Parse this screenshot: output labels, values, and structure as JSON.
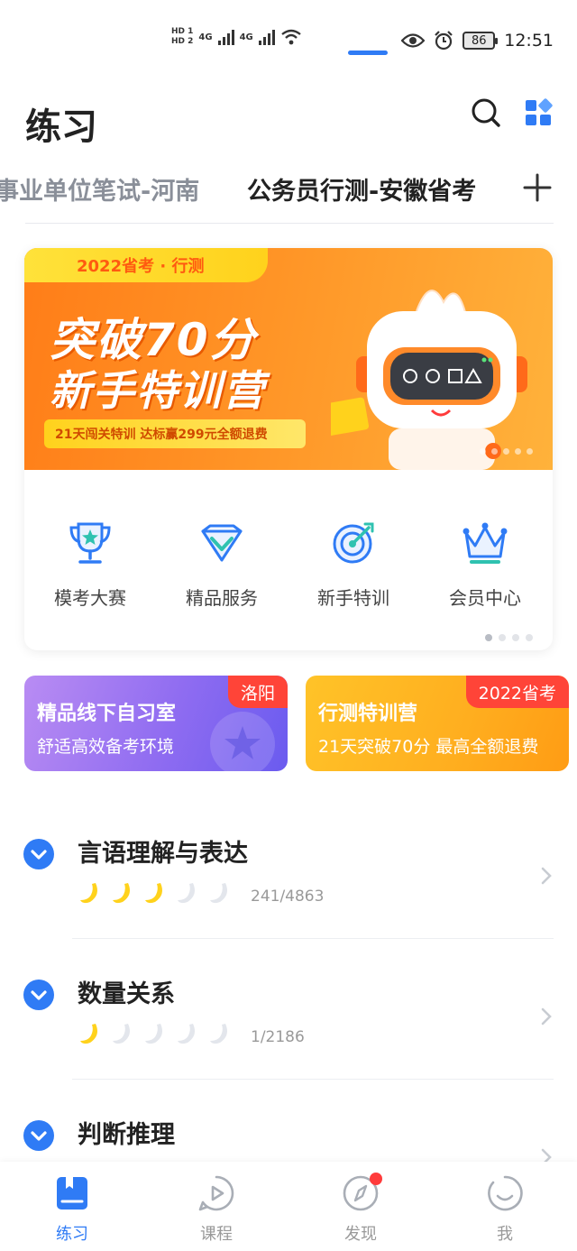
{
  "status_bar": {
    "sim1": "HD 1",
    "sim2": "HD 2",
    "net1": "4G",
    "net2": "4G",
    "battery": "86",
    "time": "12:51"
  },
  "header": {
    "title": "练习",
    "icons": [
      "search-icon",
      "grid-icon"
    ]
  },
  "tabs": {
    "items": [
      "事业单位笔试-河南",
      "公务员行测-安徽省考"
    ],
    "active_index": 1,
    "add_icon": "plus-icon"
  },
  "banner": {
    "tag": "2022省考 · 行测",
    "line1": "突破70分",
    "line2": "新手特训营",
    "subtitle": "21天闯关特训 达标赢299元全额退费",
    "colors": {
      "primary": "#ff7d18",
      "accent": "#ffd21c"
    }
  },
  "quick_menu": [
    {
      "label": "模考大赛",
      "icon": "trophy-icon"
    },
    {
      "label": "精品服务",
      "icon": "diamond-icon"
    },
    {
      "label": "新手特训",
      "icon": "target-icon"
    },
    {
      "label": "会员中心",
      "icon": "crown-icon"
    }
  ],
  "promos": [
    {
      "title": "精品线下自习室",
      "subtitle": "舒适高效备考环境",
      "badge": "洛阳"
    },
    {
      "title": "行测特训营",
      "subtitle": "21天突破70分 最高全额退费",
      "badge": "2022省考"
    }
  ],
  "practice_list": [
    {
      "title": "言语理解与表达",
      "rating": 3,
      "max_rating": 5,
      "count": "241/4863"
    },
    {
      "title": "数量关系",
      "rating": 1,
      "max_rating": 5,
      "count": "1/2186"
    },
    {
      "title": "判断推理",
      "rating": 0,
      "max_rating": 5,
      "count": ""
    }
  ],
  "bottom_nav": [
    {
      "label": "练习",
      "icon": "book-icon",
      "active": true
    },
    {
      "label": "课程",
      "icon": "play-icon",
      "active": false
    },
    {
      "label": "发现",
      "icon": "compass-icon",
      "active": false,
      "badge_dot": true
    },
    {
      "label": "我",
      "icon": "profile-icon",
      "active": false
    }
  ],
  "colors": {
    "accent": "#2f7bf5",
    "text": "#222222",
    "muted": "#999999",
    "badge_red": "#ff4438",
    "star_yellow": "#ffd21c",
    "star_grey": "#e3e6ec"
  }
}
